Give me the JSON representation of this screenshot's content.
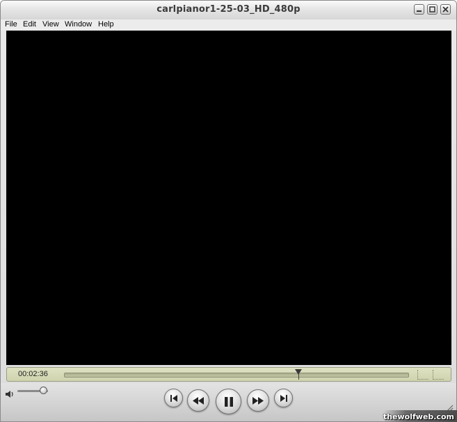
{
  "window": {
    "title": "carlpianor1-25-03_HD_480p",
    "buttons": {
      "minimize": "minimize-icon",
      "maximize": "maximize-icon",
      "close": "close-icon"
    }
  },
  "menu": {
    "items": [
      {
        "label": "File"
      },
      {
        "label": "Edit"
      },
      {
        "label": "View"
      },
      {
        "label": "Window"
      },
      {
        "label": "Help"
      }
    ]
  },
  "player": {
    "current_time": "00:02:36",
    "progress_fraction": 0.68,
    "volume_fraction": 0.85,
    "video_background": "#000000",
    "lcd_color": "#d7dab8",
    "controls": [
      {
        "name": "go-to-start-button",
        "icon": "skip-back-icon"
      },
      {
        "name": "rewind-button",
        "icon": "rewind-icon"
      },
      {
        "name": "pause-button",
        "icon": "pause-icon"
      },
      {
        "name": "fast-forward-button",
        "icon": "fast-forward-icon"
      },
      {
        "name": "go-to-end-button",
        "icon": "skip-forward-icon"
      }
    ]
  },
  "watermark": {
    "text": "thewolfweb.com"
  }
}
